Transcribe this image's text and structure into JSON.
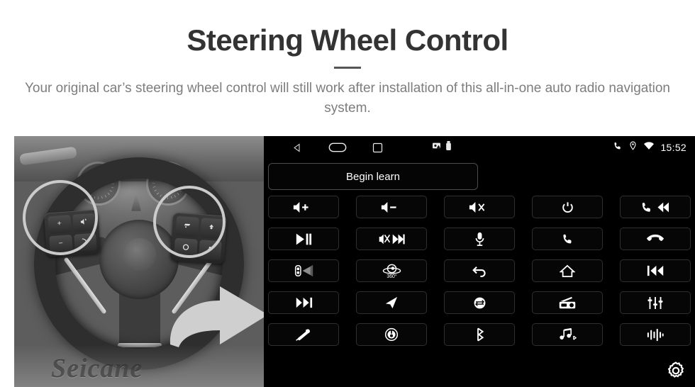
{
  "header": {
    "title": "Steering Wheel Control",
    "subtitle": "Your original car’s steering wheel control will still work after installation of this all-in-one auto radio navigation system."
  },
  "photo": {
    "watermark": "Seicane",
    "highlight_color": "#F5CF2E",
    "arrow_color": "#F7D23C",
    "left_cluster_buttons": [
      {
        "name": "volume-up",
        "label": "+"
      },
      {
        "name": "mute-speaker",
        "label": ""
      },
      {
        "name": "volume-down",
        "label": "−"
      },
      {
        "name": "phone",
        "label": ""
      }
    ],
    "right_cluster_buttons": [
      {
        "name": "cruise-set",
        "label": ""
      },
      {
        "name": "cruise-up",
        "label": ""
      },
      {
        "name": "cruise-resume",
        "label": ""
      },
      {
        "name": "cruise-down",
        "label": ""
      }
    ]
  },
  "screen": {
    "statusbar": {
      "nav_keys": [
        "back-icon",
        "home-icon",
        "recents-icon"
      ],
      "tray_icons": [
        "screenshot-icon",
        "usb-icon"
      ],
      "right_icons": [
        "phone-icon",
        "location-icon",
        "wifi-icon"
      ],
      "clock": "15:52"
    },
    "begin_learn_label": "Begin learn",
    "settings_icon": "gear-icon",
    "buttons": [
      {
        "icon": "volume-up-icon",
        "label": "+",
        "name": "btn-volume-up"
      },
      {
        "icon": "volume-down-icon",
        "label": "−",
        "name": "btn-volume-down"
      },
      {
        "icon": "volume-mute-icon",
        "label": "x",
        "name": "btn-volume-mute"
      },
      {
        "icon": "power-icon",
        "label": "",
        "name": "btn-power"
      },
      {
        "icon": "phone-prev-icon",
        "label": "",
        "name": "btn-phone-prev"
      },
      {
        "icon": "play-pause-icon",
        "label": "",
        "name": "btn-play-pause"
      },
      {
        "icon": "mute-next-icon",
        "label": "",
        "name": "btn-mute-next"
      },
      {
        "icon": "microphone-icon",
        "label": "",
        "name": "btn-microphone"
      },
      {
        "icon": "phone-answer-icon",
        "label": "",
        "name": "btn-phone-answer"
      },
      {
        "icon": "phone-hangup-icon",
        "label": "",
        "name": "btn-phone-hangup"
      },
      {
        "icon": "car-radar-icon",
        "label": "",
        "name": "btn-parking-radar"
      },
      {
        "icon": "camera-360-icon",
        "label": "360°",
        "name": "btn-camera-360"
      },
      {
        "icon": "back-arrow-icon",
        "label": "",
        "name": "btn-back"
      },
      {
        "icon": "home-icon",
        "label": "",
        "name": "btn-home"
      },
      {
        "icon": "previous-track-icon",
        "label": "",
        "name": "btn-previous-track"
      },
      {
        "icon": "next-track-icon",
        "label": "",
        "name": "btn-next-track"
      },
      {
        "icon": "navigation-icon",
        "label": "",
        "name": "btn-navigation"
      },
      {
        "icon": "mode-icon",
        "label": "",
        "name": "btn-mode"
      },
      {
        "icon": "radio-icon",
        "label": "",
        "name": "btn-radio"
      },
      {
        "icon": "equalizer-icon",
        "label": "",
        "name": "btn-equalizer"
      },
      {
        "icon": "mic-off-icon",
        "label": "",
        "name": "btn-mic-off"
      },
      {
        "icon": "dial-knob-icon",
        "label": "",
        "name": "btn-dial-knob"
      },
      {
        "icon": "bluetooth-icon",
        "label": "",
        "name": "btn-bluetooth"
      },
      {
        "icon": "bluetooth-music-icon",
        "label": "",
        "name": "btn-bluetooth-music"
      },
      {
        "icon": "voice-wave-icon",
        "label": "",
        "name": "btn-voice-assistant"
      }
    ]
  }
}
